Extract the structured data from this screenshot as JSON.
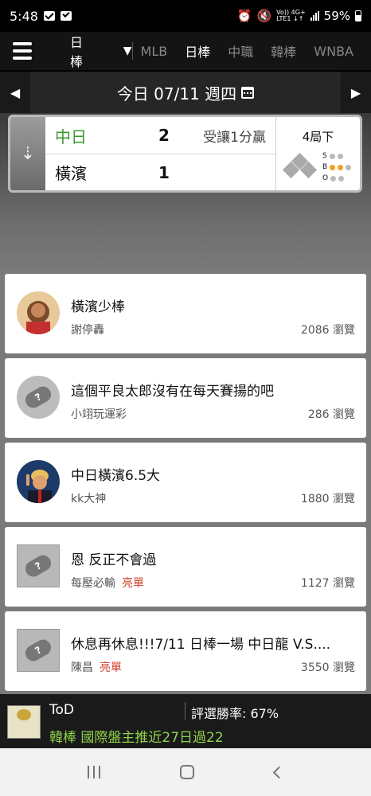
{
  "status_bar": {
    "time": "5:48",
    "battery": "59%",
    "net_top": "Vo)) 4G+",
    "net_bottom": "LTE1 ↓↑"
  },
  "nav": {
    "sport_select": "日棒",
    "tabs": [
      "MLB",
      "日棒",
      "中職",
      "韓棒",
      "WNBA"
    ],
    "active_tab": "日棒"
  },
  "date_bar": {
    "label": "今日 07/11 週四"
  },
  "scoreboard": {
    "home": {
      "name": "中日",
      "score": "2",
      "note": "受讓1分贏"
    },
    "away": {
      "name": "橫濱",
      "score": "1"
    },
    "inning": "4局下",
    "count_labels": [
      "S",
      "B",
      "O"
    ],
    "strikes": 0,
    "balls": 2,
    "outs": 0
  },
  "posts": [
    {
      "title": "橫濱少棒",
      "author": "謝停轟",
      "tag": "",
      "views": "2086 瀏覽",
      "avatar": "photo-girl"
    },
    {
      "title": "這個平良太郎沒有在每天賽揚的吧",
      "author": "小翊玩運彩",
      "tag": "",
      "views": "286 瀏覽",
      "avatar": "default-round"
    },
    {
      "title": "中日橫濱6.5大",
      "author": "kk大神",
      "tag": "",
      "views": "1880 瀏覽",
      "avatar": "photo-man"
    },
    {
      "title": "恩 反正不會過",
      "author": "每壓必輸",
      "tag": "亮單",
      "views": "1127 瀏覽",
      "avatar": "default-square"
    },
    {
      "title": "休息再休息!!!7/11 日棒一場 中日龍 V.S....",
      "author": "陳昌",
      "tag": "亮單",
      "views": "3550 瀏覽",
      "avatar": "default-square"
    }
  ],
  "banner": {
    "name": "ToD",
    "rate": "評選勝率: 67%",
    "tip": "韓棒 國際盤主推近27日過22"
  },
  "colors": {
    "win_green": "#3a9a2f",
    "hot_red": "#d0402a",
    "tip_green": "#8fd34a",
    "ball_orange": "#f0a020"
  }
}
